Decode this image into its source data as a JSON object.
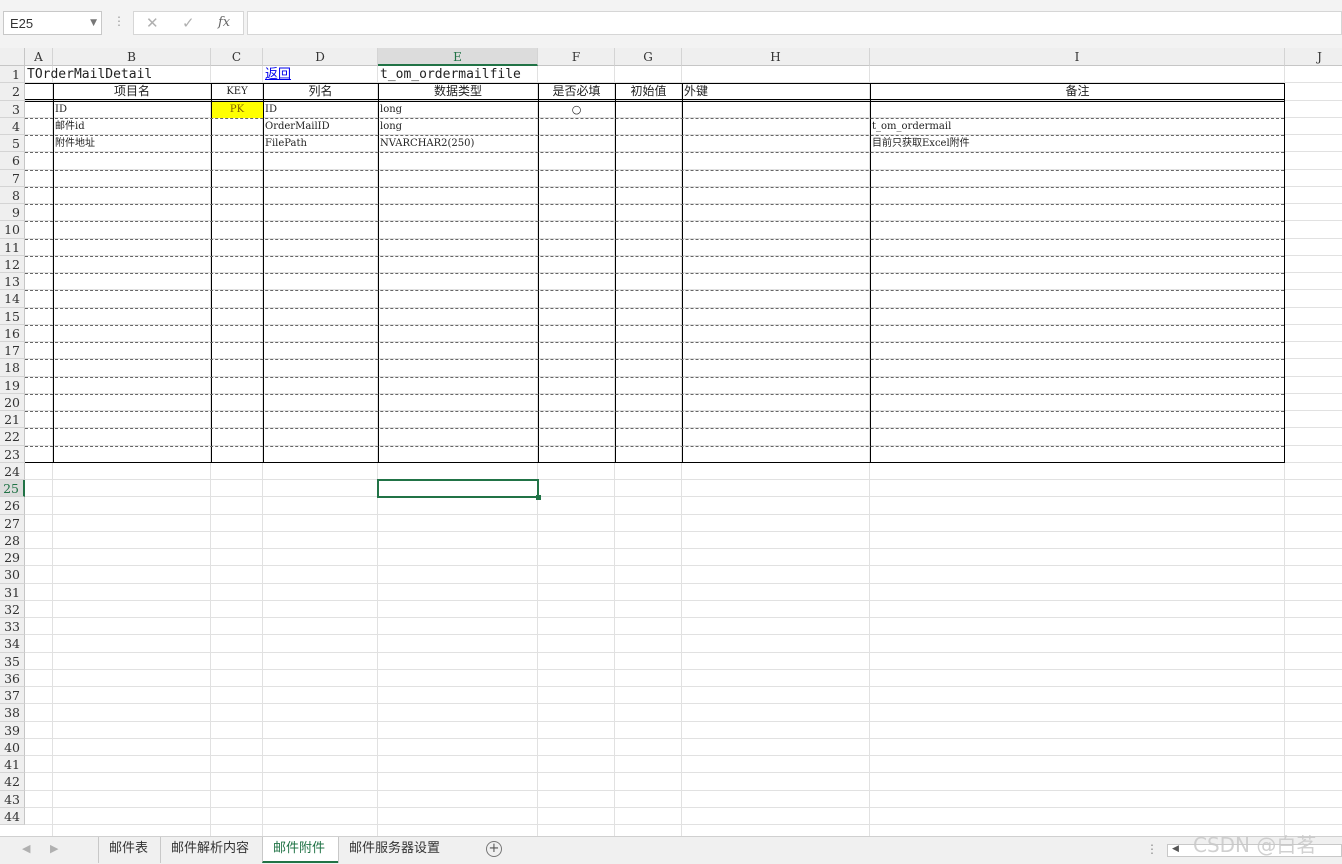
{
  "formula_bar": {
    "name_box": "E25",
    "x_icon": "close-icon",
    "check_icon": "check-icon",
    "fx_label": "fx",
    "formula": ""
  },
  "columns": [
    "A",
    "B",
    "C",
    "D",
    "E",
    "F",
    "G",
    "H",
    "I",
    "J"
  ],
  "active_column": "E",
  "active_row": 25,
  "row_count": 44,
  "cells": {
    "A1": "TOrderMailDetail",
    "D1": "返回",
    "E1": "t_om_ordermailfile",
    "B2": "项目名",
    "C2": "KEY",
    "D2": "列名",
    "E2": "数据类型",
    "F2": "是否必填",
    "G2": "初始值",
    "H2": "外键",
    "I2": "备注",
    "B3": "ID",
    "C3": "PK",
    "D3": "ID",
    "E3": "long",
    "F3": "○",
    "B4": "邮件id",
    "D4": "OrderMailID",
    "E4": "long",
    "I4": "t_om_ordermail",
    "B5": "附件地址",
    "D5": "FilePath",
    "E5": "NVARCHAR2(250)",
    "I5": "目前只获取Excel附件"
  },
  "colors": {
    "accent": "#217346",
    "pk_fill": "#ffff00",
    "link": "#0000ee"
  },
  "sheet_tabs": [
    {
      "label": "邮件表",
      "active": false
    },
    {
      "label": "邮件解析内容",
      "active": false
    },
    {
      "label": "邮件附件",
      "active": true
    },
    {
      "label": "邮件服务器设置",
      "active": false
    }
  ],
  "add_sheet_icon": "plus-circle-icon",
  "watermark": "CSDN @白茗"
}
